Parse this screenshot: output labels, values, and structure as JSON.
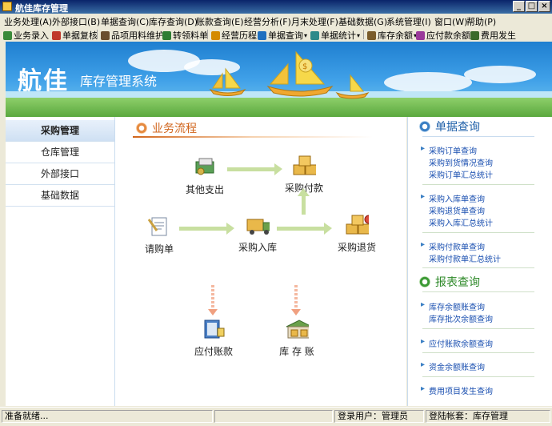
{
  "window": {
    "title": "航佳库存管理",
    "controls": [
      "_",
      "□",
      "×"
    ]
  },
  "menu": [
    {
      "label": "业务处理(A)"
    },
    {
      "label": "外部接口(B)"
    },
    {
      "label": "单据查询(C)"
    },
    {
      "label": "库存查询(D)"
    },
    {
      "label": "账款查询(E)"
    },
    {
      "label": "经营分析(F)"
    },
    {
      "label": "月末处理(F)"
    },
    {
      "label": "基础数据(G)"
    },
    {
      "label": "系统管理(I)"
    },
    {
      "label": "窗口(W)"
    },
    {
      "label": "帮助(P)"
    }
  ],
  "toolbar": [
    {
      "label": "业务录入",
      "icon": "gear-icon",
      "color": "#3a8a3a"
    },
    {
      "label": "单据复核",
      "icon": "check-icon",
      "color": "#c0392b"
    },
    {
      "label": "品项用料维护",
      "icon": "list-icon",
      "color": "#6a4e2e"
    },
    {
      "label": "转领料单",
      "icon": "transfer-icon",
      "color": "#2e7d32"
    },
    {
      "label": "经营历程",
      "icon": "chart-icon",
      "color": "#d48a00"
    },
    {
      "label": "单据查询",
      "icon": "search-icon",
      "color": "#1f6fbf",
      "dropdown": true
    },
    {
      "label": "单据统计",
      "icon": "table-icon",
      "color": "#2d8a8a",
      "dropdown": true
    },
    {
      "label": "库存余额",
      "icon": "inventory-icon",
      "color": "#7a5c2a",
      "dropdown": true
    },
    {
      "label": "应付款余额",
      "icon": "payable-icon",
      "color": "#9a3a9a"
    },
    {
      "label": "费用发生",
      "icon": "money-icon",
      "color": "#3a6a2a"
    }
  ],
  "banner": {
    "title": "航佳",
    "subtitle": "库存管理系统"
  },
  "sidebar": [
    {
      "label": "采购管理",
      "active": true
    },
    {
      "label": "仓库管理",
      "active": false
    },
    {
      "label": "外部接口",
      "active": false
    },
    {
      "label": "基础数据",
      "active": false
    }
  ],
  "flow": {
    "title": "业务流程",
    "nodes": {
      "other_expense": "其他支出",
      "purchase_payment": "采购付款",
      "requisition": "请购单",
      "purchase_receipt": "采购入库",
      "purchase_return": "采购退货",
      "payable_account": "应付账款",
      "inventory_account": "库 存 账"
    }
  },
  "query": {
    "title": "单据查询",
    "groups": [
      [
        "采购订单查询",
        "采购到货情况查询",
        "采购订单汇总统计"
      ],
      [
        "采购入库单查询",
        "采购退货单查询",
        "采购入库汇总统计"
      ],
      [
        "采购付款单查询",
        "采购付款单汇总统计"
      ]
    ]
  },
  "report": {
    "title": "报表查询",
    "links": [
      "库存余额账查询",
      "库存批次余额查询",
      "应付账款余额查询",
      "资金余额账查询",
      "费用项目发生查询"
    ]
  },
  "status": {
    "ready": "准备就绪...",
    "user": "登录用户：管理员",
    "account": "登陆帐套：库存管理"
  }
}
